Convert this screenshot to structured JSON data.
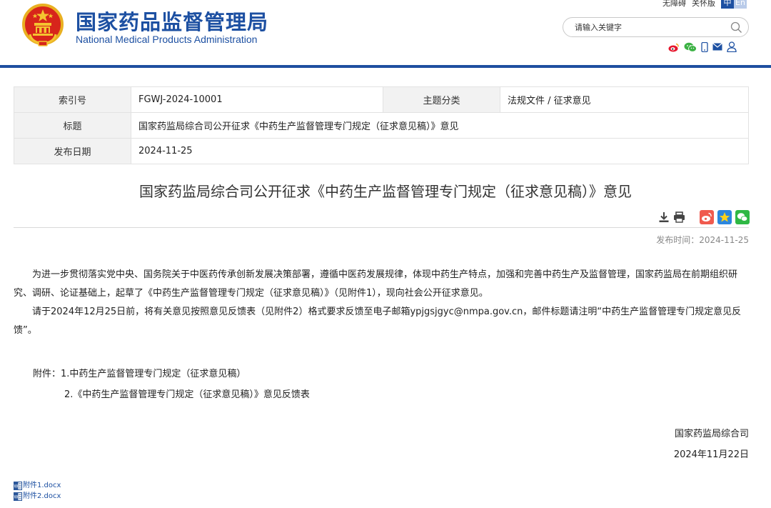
{
  "header": {
    "title_cn": "国家药品监督管理局",
    "title_en": "National Medical Products Administration",
    "util_links": [
      "无障碍",
      "关怀版"
    ],
    "lang": {
      "zh": "中",
      "en": "En"
    },
    "search_placeholder": "请输入关键字",
    "social_icons": [
      "weibo-icon",
      "wechat-icon",
      "mobile-icon",
      "mail-icon",
      "user-icon"
    ],
    "colors": {
      "brand": "#1d50a2",
      "rule": "#1f4fa0"
    }
  },
  "meta": {
    "index_label": "索引号",
    "index_value": "FGWJ-2024-10001",
    "category_label": "主题分类",
    "category_value": "法规文件 / 征求意见",
    "title_label": "标题",
    "title_value": "国家药监局综合司公开征求《中药生产监督管理专门规定（征求意见稿）》意见",
    "date_label": "发布日期",
    "date_value": "2024-11-25"
  },
  "article": {
    "title": "国家药监局综合司公开征求《中药生产监督管理专门规定（征求意见稿）》意见",
    "tools": [
      "download-icon",
      "print-icon",
      "share-weibo-icon",
      "share-qzone-icon",
      "share-wechat-icon"
    ],
    "publish_time": "发布时间：2024-11-25",
    "paragraphs": [
      "为进一步贯彻落实党中央、国务院关于中医药传承创新发展决策部署，遵循中医药发展规律，体现中药生产特点，加强和完善中药生产及监督管理，国家药监局在前期组织研究、调研、论证基础上，起草了《中药生产监督管理专门规定（征求意见稿）》（见附件1），现向社会公开征求意见。",
      "请于2024年12月25日前，将有关意见按照意见反馈表（见附件2）格式要求反馈至电子邮箱ypjgsjgyc@nmpa.gov.cn，邮件标题请注明“中药生产监督管理专门规定意见反馈”。"
    ],
    "attachments_line1": "附件：1.中药生产监督管理专门规定（征求意见稿）",
    "attachments_line2": "2.《中药生产监督管理专门规定（征求意见稿）》意见反馈表",
    "signer_org": "国家药监局综合司",
    "signer_date": "2024年11月22日",
    "files": [
      "附件1.docx",
      "附件2.docx"
    ]
  }
}
